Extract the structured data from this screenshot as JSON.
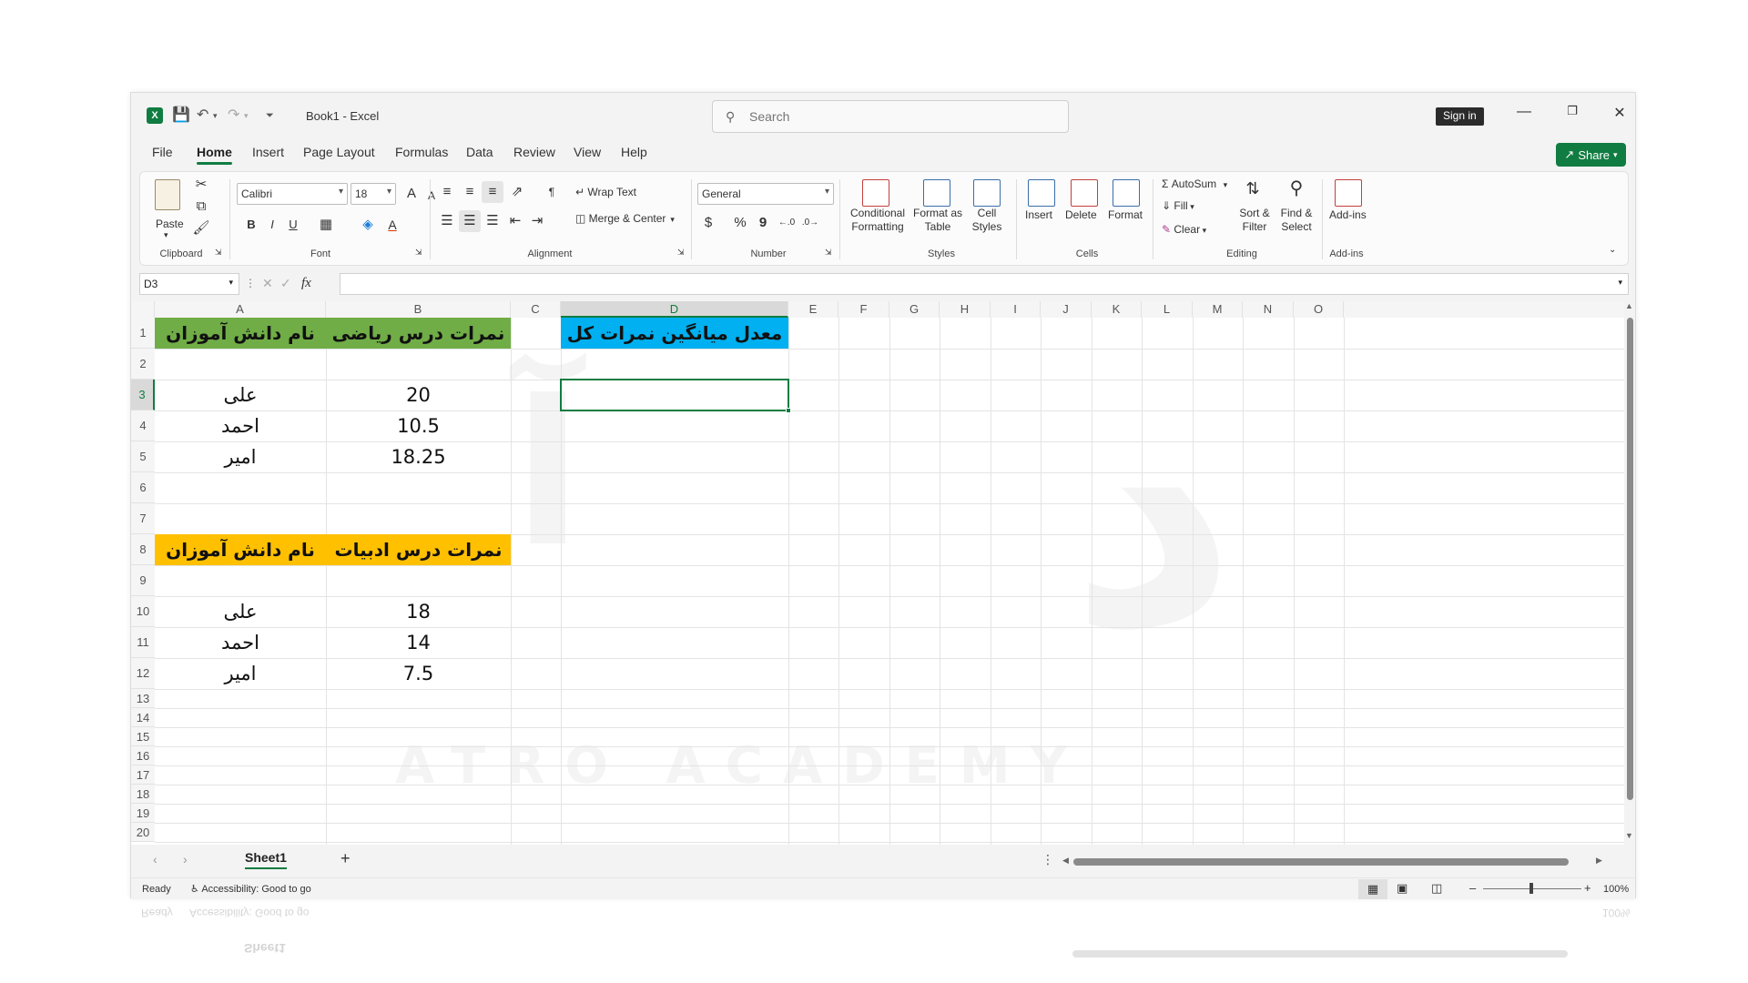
{
  "app": {
    "title": "Book1  -  Excel",
    "logo": "X"
  },
  "search": {
    "placeholder": "Search"
  },
  "account": {
    "signin": "Sign in"
  },
  "tabs": [
    "File",
    "Home",
    "Insert",
    "Page Layout",
    "Formulas",
    "Data",
    "Review",
    "View",
    "Help"
  ],
  "share": {
    "label": "Share"
  },
  "ribbon": {
    "clipboard": {
      "paste": "Paste",
      "label": "Clipboard"
    },
    "font": {
      "name": "Calibri",
      "size": "18",
      "label": "Font",
      "bold": "B",
      "italic": "I",
      "underline": "U",
      "grow": "A",
      "shrink": "A",
      "fontcolor": "A"
    },
    "alignment": {
      "wrap": "Wrap Text",
      "merge": "Merge & Center",
      "label": "Alignment"
    },
    "number": {
      "format": "General",
      "label": "Number",
      "currency": "$",
      "percent": "%",
      "comma": "9"
    },
    "styles": {
      "conditional1": "Conditional",
      "conditional2": "Formatting",
      "table1": "Format as",
      "table2": "Table",
      "cell1": "Cell",
      "cell2": "Styles",
      "label": "Styles"
    },
    "cells": {
      "insert": "Insert",
      "delete": "Delete",
      "format": "Format",
      "label": "Cells"
    },
    "editing": {
      "autosum": "AutoSum",
      "fill": "Fill",
      "clear": "Clear",
      "sort1": "Sort &",
      "sort2": "Filter",
      "find1": "Find &",
      "find2": "Select",
      "label": "Editing"
    },
    "addins": {
      "label_btn": "Add-ins",
      "label": "Add-ins"
    }
  },
  "formula_bar": {
    "namebox": "D3",
    "fx": "fx",
    "value": ""
  },
  "columns": [
    "A",
    "B",
    "C",
    "D",
    "E",
    "F",
    "G",
    "H",
    "I",
    "J",
    "K",
    "L",
    "M",
    "N",
    "O"
  ],
  "rows": [
    "1",
    "2",
    "3",
    "4",
    "5",
    "6",
    "7",
    "8",
    "9",
    "10",
    "11",
    "12",
    "13",
    "14",
    "15",
    "16",
    "17",
    "18",
    "19",
    "20"
  ],
  "sheet": {
    "a1": "نام دانش آموزان",
    "b1": "نمرات درس ریاضی",
    "d1": "معدل میانگین نمرات کل",
    "a3": "علی",
    "b3": "20",
    "a4": "احمد",
    "b4": "10.5",
    "a5": "امیر",
    "b5": "18.25",
    "a8": "نام دانش آموزان",
    "b8": "نمرات درس ادبیات",
    "a10": "علی",
    "b10": "18",
    "a11": "احمد",
    "b11": "14",
    "a12": "امیر",
    "b12": "7.5"
  },
  "colors": {
    "green_header": "#70ad47",
    "yellow_header": "#ffc000",
    "blue_header": "#00b0f0",
    "accent": "#107c41"
  },
  "sheet_tabs": {
    "active": "Sheet1",
    "add": "+"
  },
  "status": {
    "ready": "Ready",
    "accessibility": "Accessibility: Good to go",
    "zoom": "100%"
  },
  "watermark": {
    "brand": "ATRO ACADEMY"
  }
}
